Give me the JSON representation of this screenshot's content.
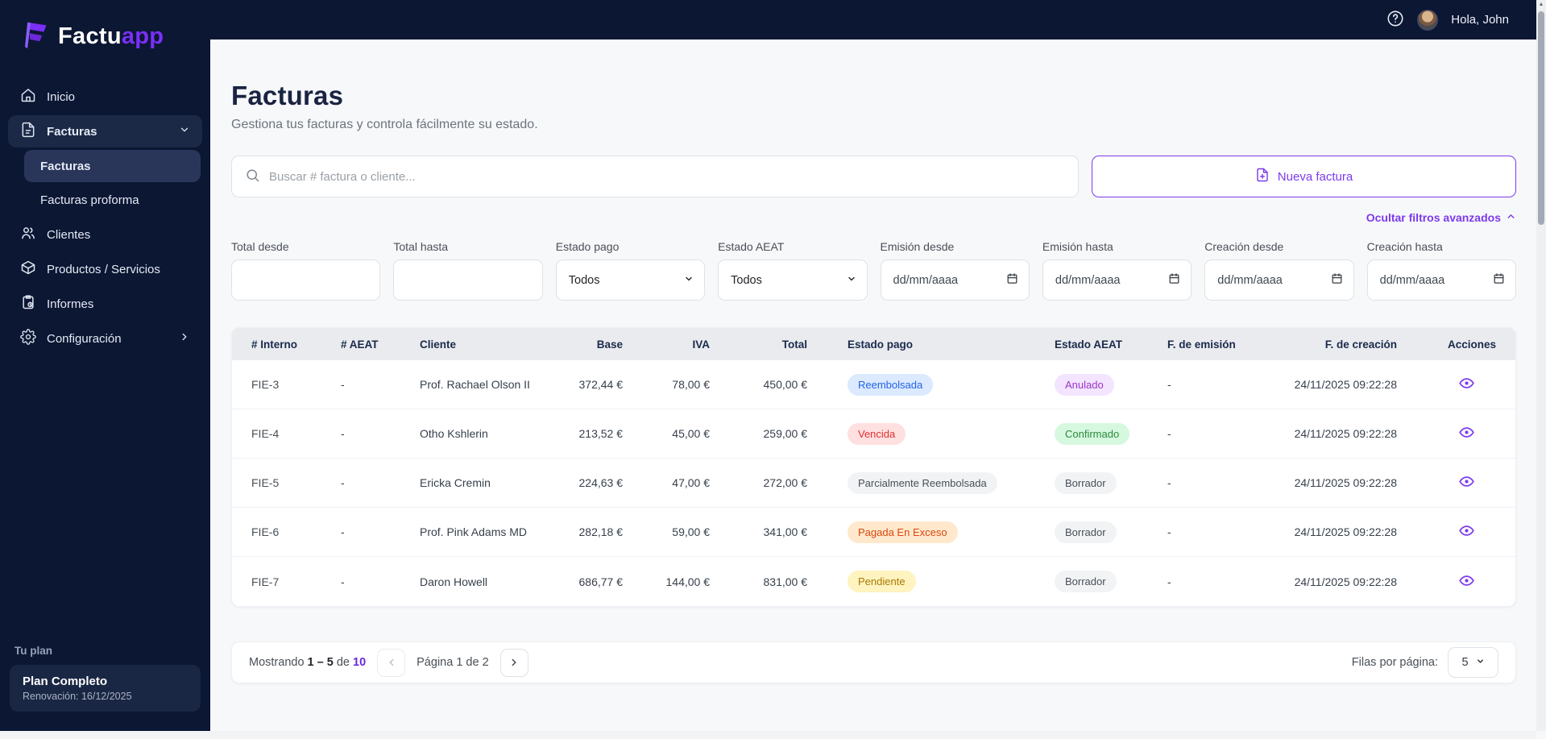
{
  "brand": {
    "primary": "Factu",
    "secondary": "app"
  },
  "topbar": {
    "greeting": "Hola, John"
  },
  "sidebar": {
    "items": [
      {
        "label": "Inicio"
      },
      {
        "label": "Facturas"
      },
      {
        "label": "Clientes"
      },
      {
        "label": "Productos / Servicios"
      },
      {
        "label": "Informes"
      },
      {
        "label": "Configuración"
      }
    ],
    "facturas_submenu": [
      {
        "label": "Facturas"
      },
      {
        "label": "Facturas proforma"
      }
    ],
    "plan": {
      "title": "Tu plan",
      "name": "Plan Completo",
      "renewal": "Renovación: 16/12/2025"
    }
  },
  "page": {
    "title": "Facturas",
    "subtitle": "Gestiona tus facturas y controla fácilmente su estado.",
    "search_placeholder": "Buscar # factura o cliente...",
    "new_invoice": "Nueva factura",
    "toggle_filters": "Ocultar filtros avanzados"
  },
  "filters": {
    "total_desde": {
      "label": "Total desde",
      "value": ""
    },
    "total_hasta": {
      "label": "Total hasta",
      "value": ""
    },
    "estado_pago": {
      "label": "Estado pago",
      "value": "Todos"
    },
    "estado_aeat": {
      "label": "Estado AEAT",
      "value": "Todos"
    },
    "emision_desde": {
      "label": "Emisión desde",
      "placeholder": "dd/mm/aaaa"
    },
    "emision_hasta": {
      "label": "Emisión hasta",
      "placeholder": "dd/mm/aaaa"
    },
    "creacion_desde": {
      "label": "Creación desde",
      "placeholder": "dd/mm/aaaa"
    },
    "creacion_hasta": {
      "label": "Creación hasta",
      "placeholder": "dd/mm/aaaa"
    }
  },
  "table": {
    "columns": [
      "# Interno",
      "# AEAT",
      "Cliente",
      "Base",
      "IVA",
      "Total",
      "Estado pago",
      "Estado AEAT",
      "F. de emisión",
      "F. de creación",
      "Acciones"
    ],
    "rows": [
      {
        "interno": "FIE-3",
        "aeat": "-",
        "cliente": "Prof. Rachael Olson II",
        "base": "372,44 €",
        "iva": "78,00 €",
        "total": "450,00 €",
        "estado_pago": {
          "text": "Reembolsada",
          "style": "blue"
        },
        "estado_aeat": {
          "text": "Anulado",
          "style": "purple"
        },
        "f_emision": "-",
        "f_creacion": "24/11/2025 09:22:28"
      },
      {
        "interno": "FIE-4",
        "aeat": "-",
        "cliente": "Otho Kshlerin",
        "base": "213,52 €",
        "iva": "45,00 €",
        "total": "259,00 €",
        "estado_pago": {
          "text": "Vencida",
          "style": "red"
        },
        "estado_aeat": {
          "text": "Confirmado",
          "style": "green"
        },
        "f_emision": "-",
        "f_creacion": "24/11/2025 09:22:28"
      },
      {
        "interno": "FIE-5",
        "aeat": "-",
        "cliente": "Ericka Cremin",
        "base": "224,63 €",
        "iva": "47,00 €",
        "total": "272,00 €",
        "estado_pago": {
          "text": "Parcialmente Reembolsada",
          "style": "gray"
        },
        "estado_aeat": {
          "text": "Borrador",
          "style": "gray"
        },
        "f_emision": "-",
        "f_creacion": "24/11/2025 09:22:28"
      },
      {
        "interno": "FIE-6",
        "aeat": "-",
        "cliente": "Prof. Pink Adams MD",
        "base": "282,18 €",
        "iva": "59,00 €",
        "total": "341,00 €",
        "estado_pago": {
          "text": "Pagada En Exceso",
          "style": "orange"
        },
        "estado_aeat": {
          "text": "Borrador",
          "style": "gray"
        },
        "f_emision": "-",
        "f_creacion": "24/11/2025 09:22:28"
      },
      {
        "interno": "FIE-7",
        "aeat": "-",
        "cliente": "Daron Howell",
        "base": "686,77 €",
        "iva": "144,00 €",
        "total": "831,00 €",
        "estado_pago": {
          "text": "Pendiente",
          "style": "yellow"
        },
        "estado_aeat": {
          "text": "Borrador",
          "style": "gray"
        },
        "f_emision": "-",
        "f_creacion": "24/11/2025 09:22:28"
      }
    ]
  },
  "badge_styles": {
    "blue": {
      "bg": "#dbeafe",
      "fg": "#2563eb"
    },
    "purple": {
      "bg": "#f3e4ff",
      "fg": "#9c36c5"
    },
    "red": {
      "bg": "#ffe0e0",
      "fg": "#e03131"
    },
    "green": {
      "bg": "#d6f8df",
      "fg": "#2b8a3e"
    },
    "gray": {
      "bg": "#f1f3f5",
      "fg": "#495057"
    },
    "orange": {
      "bg": "#ffe8cc",
      "fg": "#d9480f"
    },
    "yellow": {
      "bg": "#fff3bf",
      "fg": "#a87900"
    }
  },
  "pagination": {
    "mostrando": "Mostrando",
    "range": "1 – 5",
    "de": "de",
    "total": "10",
    "page_info": "Página 1 de 2",
    "rows_per_page_label": "Filas por página:",
    "rows_per_page": "5"
  },
  "colors": {
    "accent": "#7c3aed",
    "sidebar_bg": "#0b1733",
    "logo_purple": "#7b2ff7",
    "title_navy": "#1a2442"
  }
}
